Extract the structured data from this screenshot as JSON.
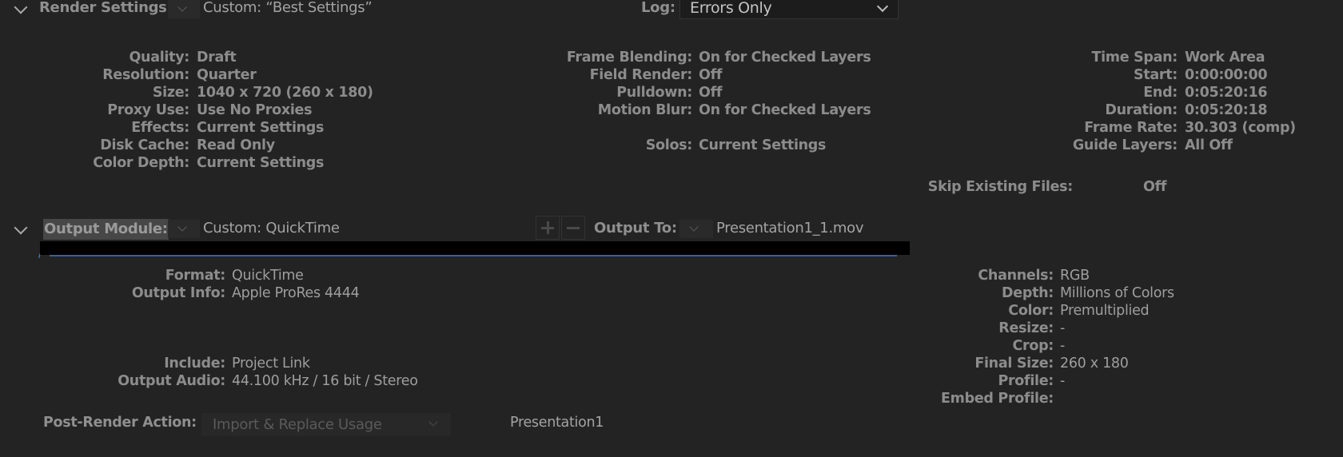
{
  "render_settings": {
    "title": "Render Settings:",
    "preset": "Custom: “Best Settings”",
    "log_label": "Log:",
    "log_value": "Errors Only",
    "col1": [
      {
        "label": "Quality:",
        "value": "Draft"
      },
      {
        "label": "Resolution:",
        "value": "Quarter"
      },
      {
        "label": "Size:",
        "value": "1040 x 720 (260 x 180)"
      },
      {
        "label": "Proxy Use:",
        "value": "Use No Proxies"
      },
      {
        "label": "Effects:",
        "value": "Current Settings"
      },
      {
        "label": "Disk Cache:",
        "value": "Read Only"
      },
      {
        "label": "Color Depth:",
        "value": "Current Settings"
      }
    ],
    "col2": [
      {
        "label": "Frame Blending:",
        "value": "On for Checked Layers"
      },
      {
        "label": "Field Render:",
        "value": "Off"
      },
      {
        "label": "Pulldown:",
        "value": "Off"
      },
      {
        "label": "Motion Blur:",
        "value": "On for Checked Layers"
      },
      {
        "label": "Solos:",
        "value": "Current Settings"
      }
    ],
    "col3": [
      {
        "label": "Time Span:",
        "value": "Work Area"
      },
      {
        "label": "Start:",
        "value": "0:00:00:00"
      },
      {
        "label": "End:",
        "value": "0:05:20:16"
      },
      {
        "label": "Duration:",
        "value": "0:05:20:18"
      },
      {
        "label": "Frame Rate:",
        "value": "30.303 (comp)"
      },
      {
        "label": "Guide Layers:",
        "value": "All Off"
      }
    ],
    "skip": {
      "label": "Skip Existing Files:",
      "value": "Off"
    }
  },
  "output_module": {
    "title": "Output Module:",
    "preset": "Custom: QuickTime",
    "output_to_label": "Output To:",
    "output_file": "Presentation1_1.mov",
    "left": [
      {
        "label": "Format:",
        "value": "QuickTime"
      },
      {
        "label": "Output Info:",
        "value": "Apple ProRes 4444"
      }
    ],
    "left2": [
      {
        "label": "Include:",
        "value": "Project Link"
      },
      {
        "label": "Output Audio:",
        "value": "44.100 kHz / 16 bit / Stereo"
      }
    ],
    "right": [
      {
        "label": "Channels:",
        "value": "RGB"
      },
      {
        "label": "Depth:",
        "value": "Millions of Colors"
      },
      {
        "label": "Color:",
        "value": "Premultiplied"
      },
      {
        "label": "Resize:",
        "value": "-"
      },
      {
        "label": "Crop:",
        "value": "-"
      },
      {
        "label": "Final Size:",
        "value": "260 x 180"
      },
      {
        "label": "Profile:",
        "value": "-"
      },
      {
        "label": "Embed Profile:",
        "value": ""
      }
    ],
    "post_render_label": "Post-Render Action:",
    "post_render_value": "Import & Replace Usage",
    "post_render_target": "Presentation1"
  },
  "colors": {
    "background": "#232323",
    "path_link": "#3d7fd6"
  }
}
